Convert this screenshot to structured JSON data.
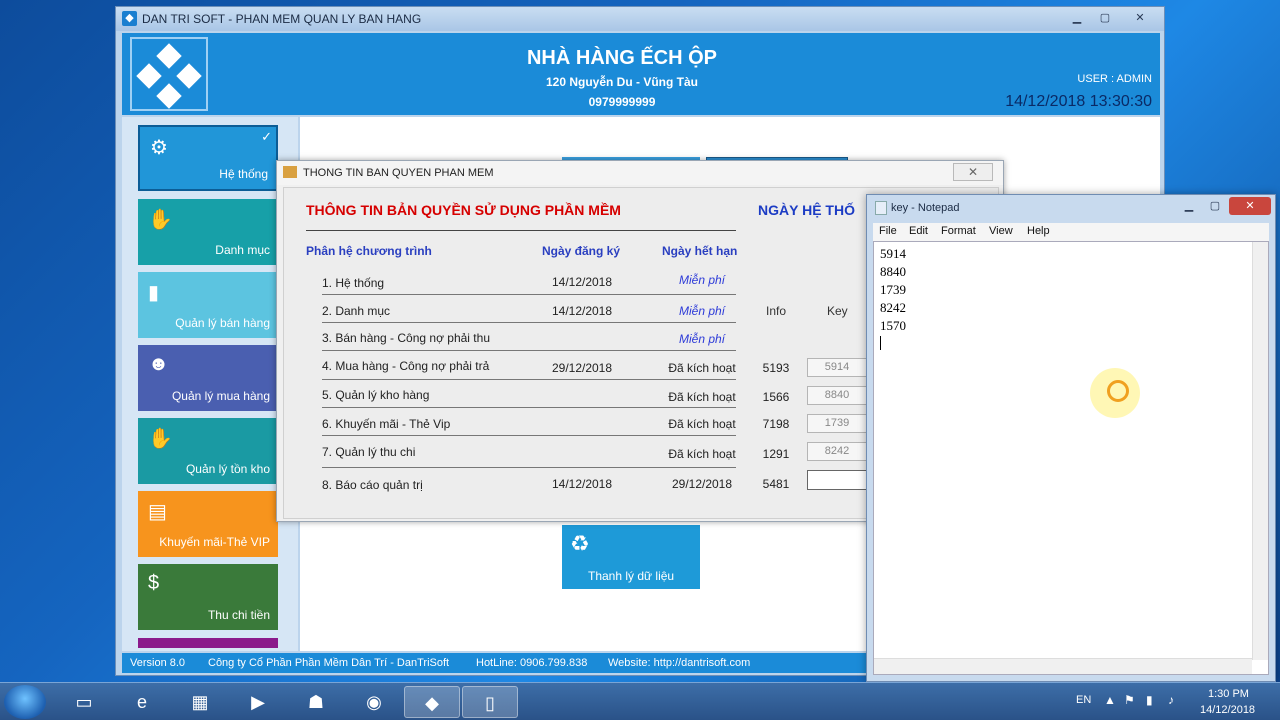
{
  "app": {
    "title": "DAN TRI SOFT - PHAN MEM QUAN LY BAN HANG",
    "shop_name": "NHÀ HÀNG ẾCH ỘP",
    "shop_address": "120 Nguyễn Du - Vũng Tàu",
    "shop_phone": "0979999999",
    "user_label": "USER : ADMIN",
    "datetime": "14/12/2018 13:30:30"
  },
  "menu": [
    {
      "label": "Hệ thống",
      "color": "#2196d8",
      "icon": "gear-icon"
    },
    {
      "label": "Danh mục",
      "color": "#17a0a8",
      "icon": "hand-box-icon"
    },
    {
      "label": "Quản lý bán hàng",
      "color": "#5cc4e0",
      "icon": "bar-chart-icon"
    },
    {
      "label": "Quản lý mua hàng",
      "color": "#4a5fb0",
      "icon": "buyer-icon"
    },
    {
      "label": "Quản lý tồn kho",
      "color": "#1a9aa3",
      "icon": "stock-icon"
    },
    {
      "label": "Khuyến mãi-Thẻ VIP",
      "color": "#f7941d",
      "icon": "vip-card-icon"
    },
    {
      "label": "Thu chi tiền",
      "color": "#3a7a3a",
      "icon": "money-icon"
    }
  ],
  "content": {
    "thanh_ly_label": "Thanh lý dữ liệu"
  },
  "status_bar": {
    "version": "Version 8.0",
    "company": "Công ty Cổ Phần Phần Mềm Dân Trí - DanTriSoft",
    "hotline": "HotLine: 0906.799.838",
    "website": "Website: http://dantrisoft.com"
  },
  "license_dialog": {
    "title": "THONG TIN BAN QUYEN PHAN MEM",
    "heading": "THÔNG TIN BẢN QUYỀN SỬ DỤNG PHẦN MỀM",
    "heading2": "NGÀY HỆ THỐ",
    "col_module": "Phân hệ chương trình",
    "col_reg": "Ngày đăng ký",
    "col_exp": "Ngày hết hạn",
    "col_info": "Info",
    "col_key": "Key",
    "rows": [
      {
        "name": "1. Hệ thống",
        "reg": "14/12/2018",
        "exp": "Miễn phí",
        "info": "",
        "key": ""
      },
      {
        "name": "2. Danh mục",
        "reg": "14/12/2018",
        "exp": "Miễn phí",
        "info": "",
        "key": ""
      },
      {
        "name": "3. Bán hàng - Công nợ phải thu",
        "reg": "",
        "exp": "Miễn phí",
        "info": "",
        "key": ""
      },
      {
        "name": "4. Mua hàng - Công nợ phải trả",
        "reg": "29/12/2018",
        "exp": "Đã kích hoạt",
        "info": "5193",
        "key": "5914"
      },
      {
        "name": "5. Quản lý kho hàng",
        "reg": "",
        "exp": "Đã kích hoạt",
        "info": "1566",
        "key": "8840"
      },
      {
        "name": "6. Khuyến mãi - Thẻ Vip",
        "reg": "",
        "exp": "Đã kích hoạt",
        "info": "7198",
        "key": "1739"
      },
      {
        "name": "7. Quản lý thu chi",
        "reg": "",
        "exp": "Đã kích hoạt",
        "info": "1291",
        "key": "8242"
      },
      {
        "name": "8. Báo cáo quản trị",
        "reg": "14/12/2018",
        "exp": "29/12/2018",
        "info": "5481",
        "key": ""
      }
    ]
  },
  "notepad": {
    "title": "key - Notepad",
    "menu": [
      "File",
      "Edit",
      "Format",
      "View",
      "Help"
    ],
    "lines": [
      "5914",
      "8840",
      "1739",
      "8242",
      "1570"
    ]
  },
  "taskbar": {
    "lang": "EN",
    "time": "1:30 PM",
    "date": "14/12/2018"
  }
}
